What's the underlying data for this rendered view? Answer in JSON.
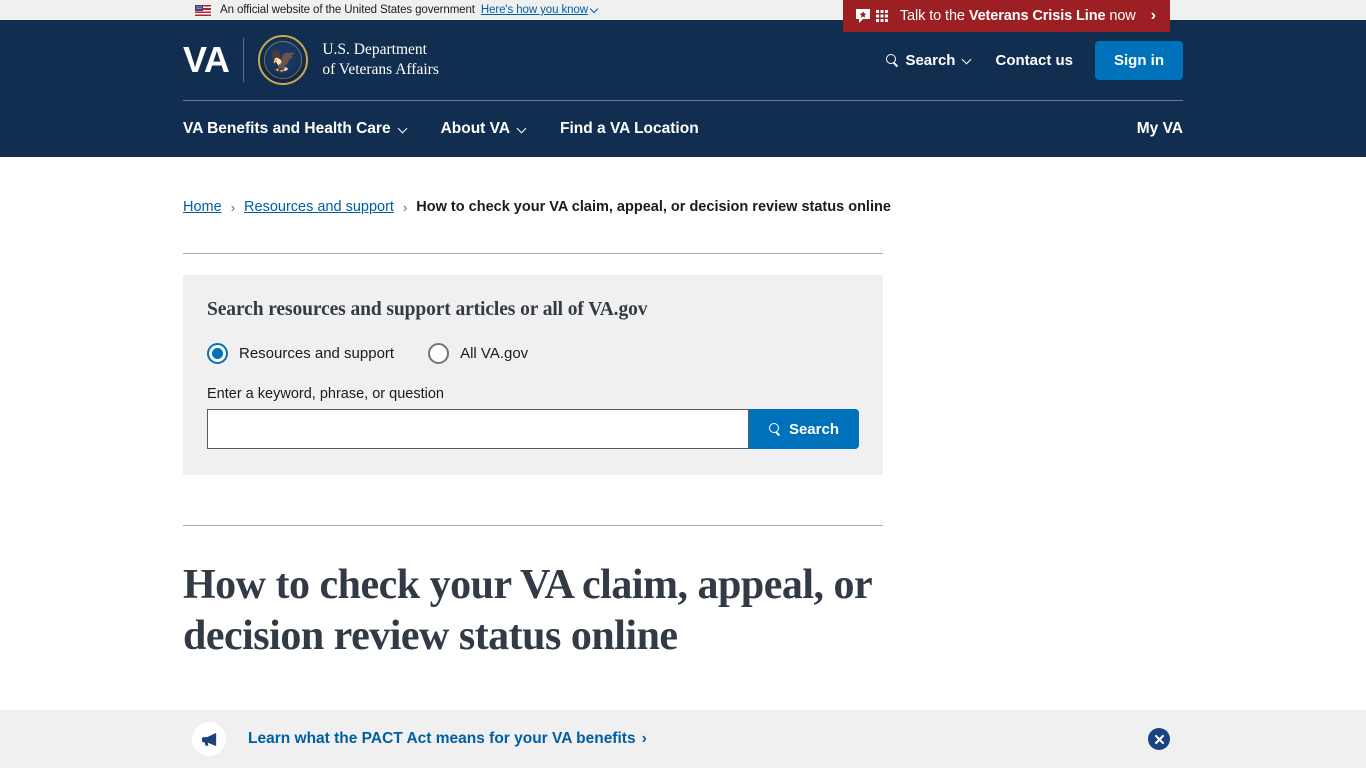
{
  "gov_banner": {
    "icon": "us-flag-icon",
    "text": "An official website of the United States government",
    "link_label": "Here's how you know"
  },
  "crisis_banner": {
    "icon": "crisis-chat-keypad-icon",
    "text_prefix": "Talk to the ",
    "text_bold": "Veterans Crisis Line",
    "text_suffix": " now",
    "arrow": "›",
    "background_color": "#9c1f23"
  },
  "header": {
    "logo": {
      "wordmark": "VA",
      "seal_icon": "va-seal-icon",
      "department_line1": "U.S. Department",
      "department_line2": "of Veterans Affairs"
    },
    "actions": {
      "search_label": "Search",
      "search_icon": "search-icon",
      "search_chevron_icon": "chevron-down-icon",
      "contact_label": "Contact us",
      "signin_label": "Sign in",
      "signin_color": "#0071bb"
    },
    "nav": {
      "items": [
        {
          "label": "VA Benefits and Health Care",
          "has_chevron": true
        },
        {
          "label": "About VA",
          "has_chevron": true
        },
        {
          "label": "Find a VA Location",
          "has_chevron": false
        }
      ],
      "my_va_label": "My VA"
    },
    "background_color": "#112e51"
  },
  "breadcrumb": {
    "home": "Home",
    "separator": "›",
    "resources": "Resources and support",
    "current": "How to check your VA claim, appeal, or decision review status online"
  },
  "search_panel": {
    "title": "Search resources and support articles or all of VA.gov",
    "options": [
      {
        "label": "Resources and support",
        "checked": true
      },
      {
        "label": "All VA.gov",
        "checked": false
      }
    ],
    "field_label": "Enter a keyword, phrase, or question",
    "input_value": "",
    "input_placeholder": "",
    "button_label": "Search",
    "button_icon": "search-icon",
    "background_color": "#f0f0f0",
    "accent_color": "#0071bb"
  },
  "page_title": "How to check your VA claim, appeal, or decision review status online",
  "pact_banner": {
    "icon": "megaphone-icon",
    "link_label": "Learn what the PACT Act means for your VA benefits",
    "chevron": "›",
    "close_icon": "close-icon",
    "background_color": "#f0f0f0",
    "link_color": "#005ea2"
  }
}
